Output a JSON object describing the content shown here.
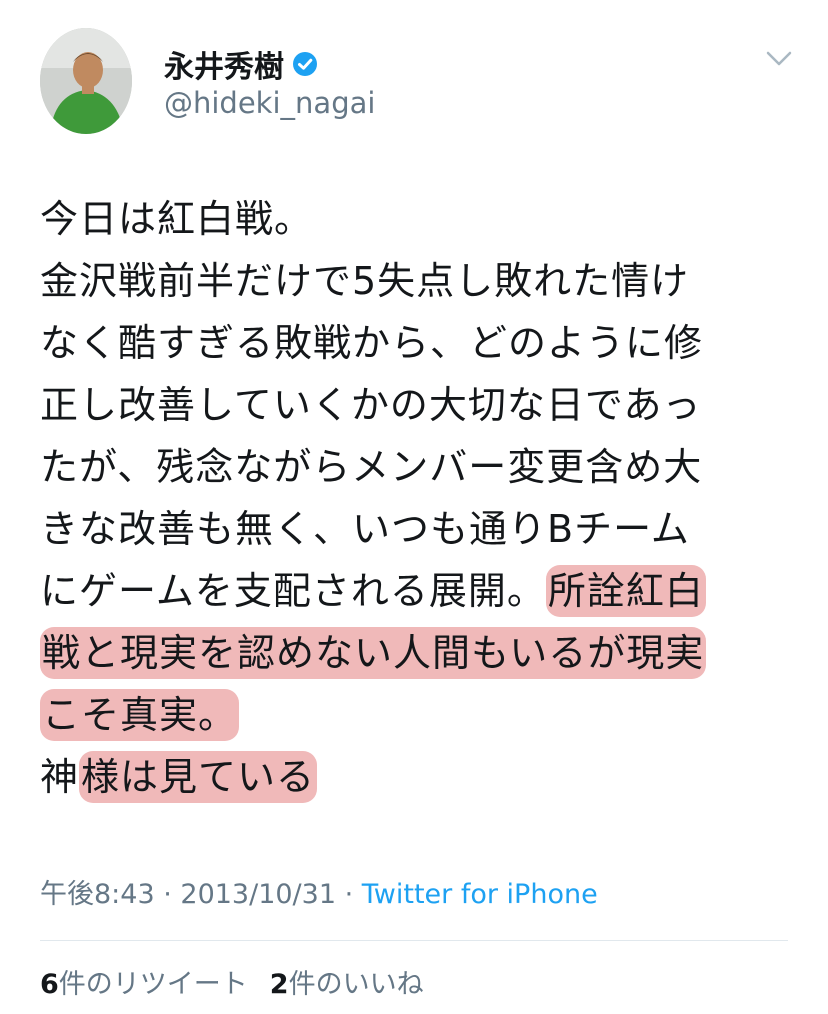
{
  "user": {
    "name": "永井秀樹",
    "handle": "@hideki_nagai"
  },
  "tweet": {
    "lines": [
      "今日は紅白戦。",
      "金沢戦前半だけで5失点し敗れた情け",
      "なく酷すぎる敗戦から、どのように修",
      "正し改善していくかの大切な日であっ",
      "たが、残念ながらメンバー変更含め大",
      "きな改善も無く、いつも通りBチーム"
    ],
    "line7_plain": "にゲームを支配される展開。",
    "line7_highlight": "所詮紅白",
    "line8_highlight": "戦と現実を認めない人間もいるが現実",
    "line9_highlight": "こそ真実。",
    "line10_plain": "神",
    "line10_highlight": "様は見ている"
  },
  "meta": {
    "time": "午後8:43",
    "sep1": " · ",
    "date": "2013/10/31",
    "sep2": " · ",
    "source": "Twitter for iPhone"
  },
  "stats": {
    "retweets_count": "6",
    "retweets_label": "件のリツイート",
    "likes_count": "2",
    "likes_label": "件のいいね"
  },
  "colors": {
    "text": "#14171a",
    "secondary": "#657786",
    "link": "#1da1f2",
    "verified": "#1da1f2",
    "highlight": "#e27878"
  }
}
